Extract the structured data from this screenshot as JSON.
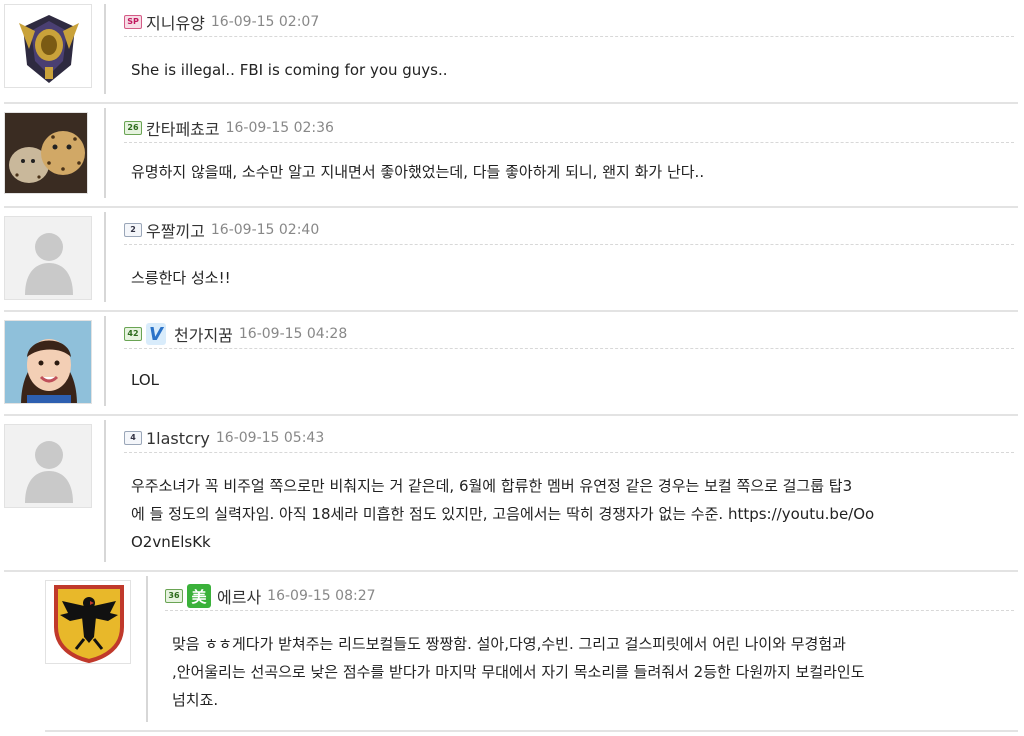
{
  "comments": [
    {
      "level": "SP",
      "nickname": "지니유양",
      "time": "16-09-15 02:07",
      "text": "She is illegal.. FBI is coming for you guys..",
      "avatar": "scarab-emblem"
    },
    {
      "level": "26",
      "nickname": "칸타페쵸코",
      "time": "16-09-15 02:36",
      "text": "유명하지 않을때, 소수만 알고 지내면서 좋아했었는데, 다들 좋아하게 되니, 왠지 화가 난다..",
      "avatar": "cheetah-photo"
    },
    {
      "level": "2",
      "nickname": "우짤끼고",
      "time": "16-09-15 02:40",
      "text": "스릉한다 성소!!",
      "avatar": "default-person"
    },
    {
      "level": "42",
      "badge": "V",
      "nickname": "천가지꿈",
      "time": "16-09-15 04:28",
      "text": "LOL",
      "avatar": "girl-photo"
    },
    {
      "level": "4",
      "nickname": "1lastcry",
      "time": "16-09-15 05:43",
      "lines": [
        "우주소녀가 꼭 비주얼 쪽으로만 비춰지는 거 같은데, 6월에 합류한 멤버 유연정 같은 경우는 보컬 쪽으로 걸그룹 탑3",
        "에 들 정도의 실력자임. 아직 18세라 미흡한 점도 있지만, 고음에서는 딱히 경쟁자가 없는 수준. https://youtu.be/Oo",
        "O2vnElsKk"
      ],
      "avatar": "default-person"
    },
    {
      "level": "36",
      "badge": "美",
      "nickname": "에르사",
      "time": "16-09-15 08:27",
      "lines": [
        "맞음 ㅎㅎ게다가 받쳐주는 리드보컬들도 짱짱함. 설아,다영,수빈. 그리고 걸스피릿에서 어린 나이와 무경험과",
        ",안어울리는 선곡으로 낮은 점수를 받다가 마지막 무대에서 자기 목소리를 들려줘서 2등한 다원까지 보컬라인도",
        "넘치죠."
      ],
      "avatar": "german-eagle-crest"
    }
  ],
  "colors": {
    "divider": "#e3e3e3",
    "time": "#888888",
    "text": "#222222"
  }
}
